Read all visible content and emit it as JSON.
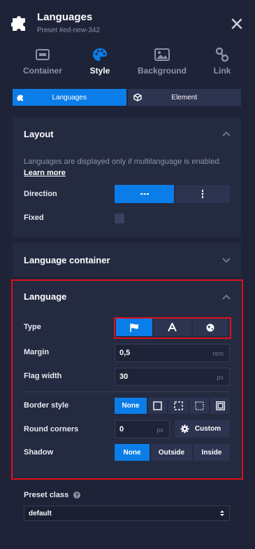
{
  "header": {
    "title": "Languages",
    "subtitle": "Preset #ed-new-342"
  },
  "tabs": [
    {
      "label": "Container",
      "icon": "container-icon",
      "active": false
    },
    {
      "label": "Style",
      "icon": "palette-icon",
      "active": true
    },
    {
      "label": "Background",
      "icon": "image-icon",
      "active": false
    },
    {
      "label": "Link",
      "icon": "link-icon",
      "active": false
    }
  ],
  "subtabs": [
    {
      "label": "Languages",
      "active": true
    },
    {
      "label": "Element",
      "active": false
    }
  ],
  "layout": {
    "title": "Layout",
    "note": "Languages are displayed only if multilanguage is enabled.",
    "learn_more": "Learn more",
    "direction_label": "Direction",
    "fixed_label": "Fixed",
    "fixed_checked": false
  },
  "language_container": {
    "title": "Language container"
  },
  "language": {
    "title": "Language",
    "type_label": "Type",
    "margin_label": "Margin",
    "margin_value": "0,5",
    "margin_unit": "rem",
    "flag_width_label": "Flag width",
    "flag_width_value": "30",
    "flag_width_unit": "px",
    "border_style_label": "Border style",
    "border_none": "None",
    "round_corners_label": "Round corners",
    "round_value": "0",
    "round_unit": "px",
    "custom_label": "Custom",
    "shadow_label": "Shadow",
    "shadow_options": [
      "None",
      "Outside",
      "Inside"
    ]
  },
  "preset": {
    "label": "Preset class",
    "value": "default"
  },
  "colors": {
    "accent": "#0b7de8",
    "highlight": "#e0101a",
    "background": "#1e2337",
    "panel": "#242a40"
  }
}
